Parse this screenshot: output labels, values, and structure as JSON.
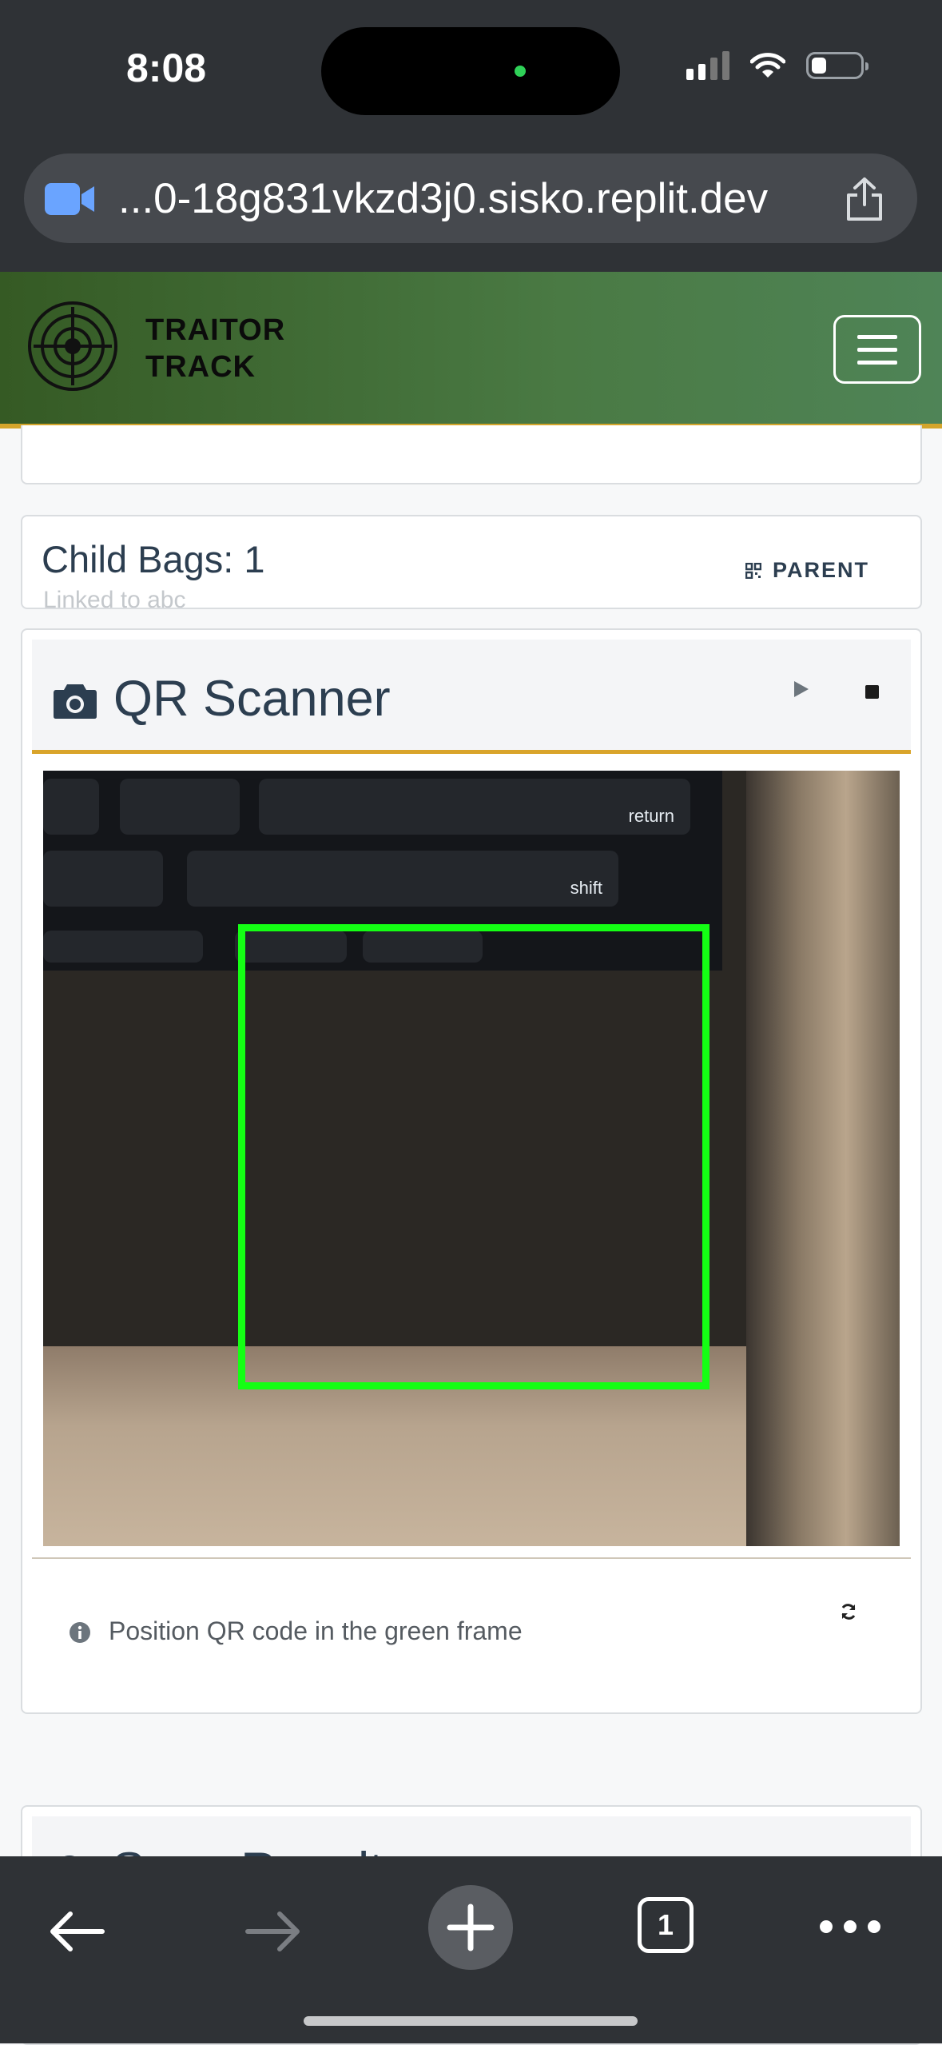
{
  "status_bar": {
    "time": "8:08"
  },
  "browser": {
    "url": "...0-18g831vkzd3j0.sisko.replit.dev",
    "tabs_count": "1"
  },
  "app": {
    "brand_line1": "TRAITOR",
    "brand_line2": "TRACK",
    "header_colors": {
      "green_dark": "#355a24",
      "green_light": "#4f8457",
      "accent": "#d4a52b"
    }
  },
  "child_bags": {
    "title": "Child Bags: 1",
    "subtitle": "Linked to abc",
    "parent_button": "PARENT"
  },
  "scanner": {
    "title": "QR Scanner",
    "hint": "Position QR code in the green frame",
    "frame_color": "#14ff14",
    "keys": [
      "return",
      "shift"
    ]
  },
  "results": {
    "title": "Scan Results"
  }
}
